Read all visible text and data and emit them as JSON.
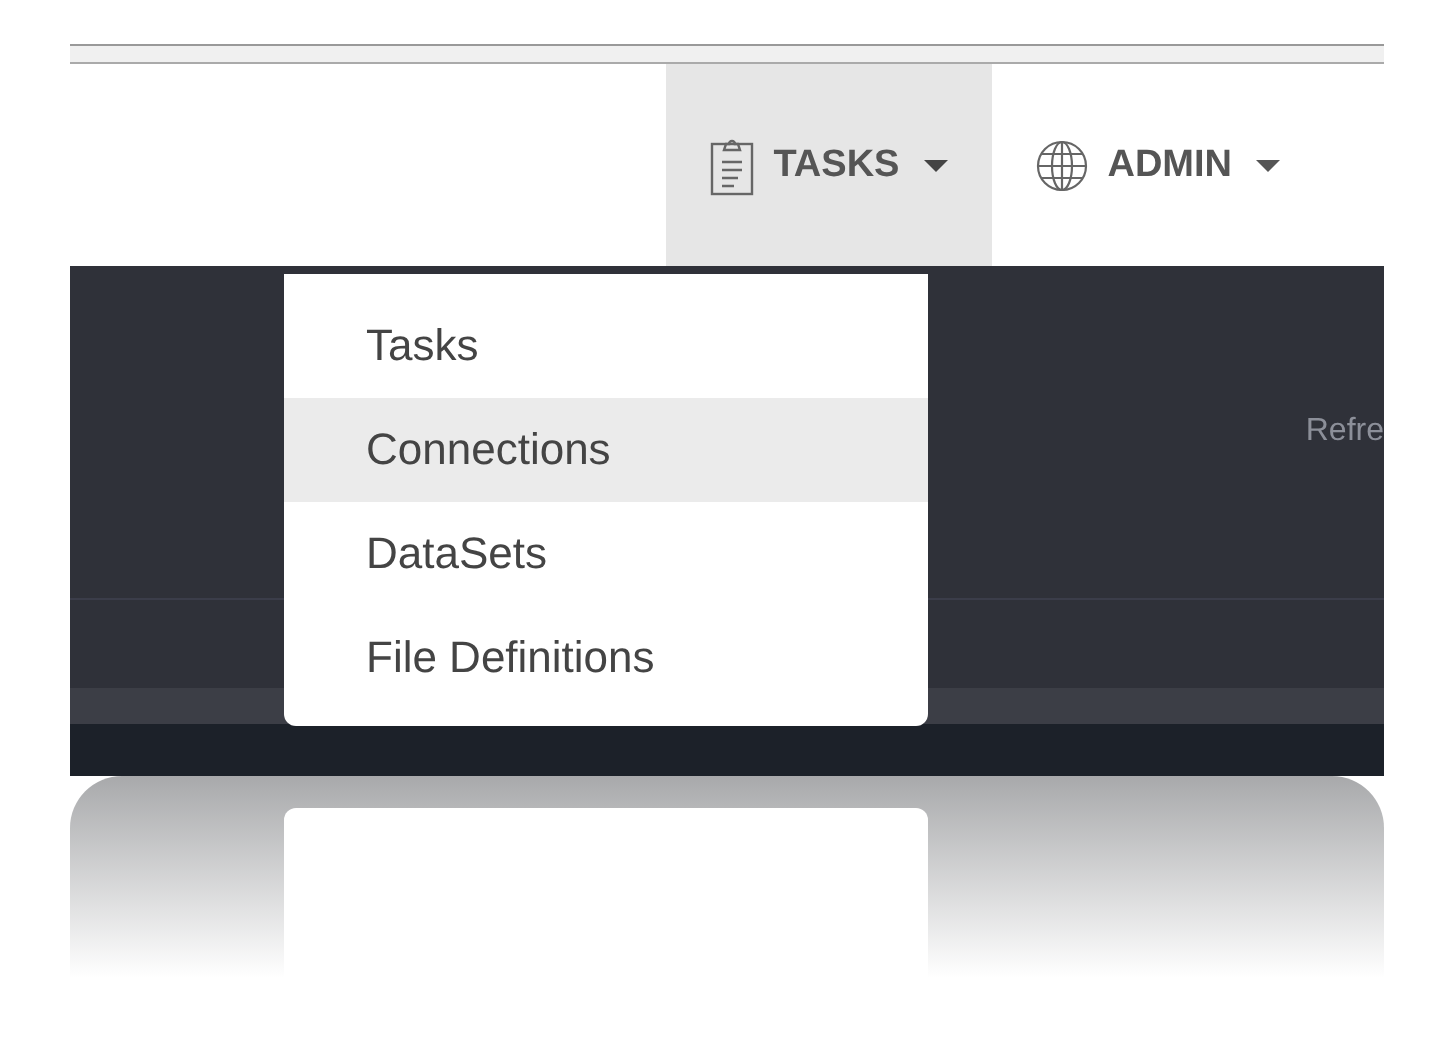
{
  "nav": {
    "buttons": [
      {
        "kind": "clipboard",
        "label": "TASKS",
        "selected": true,
        "expanded": true
      },
      {
        "kind": "globe",
        "label": "ADMIN",
        "selected": false,
        "expanded": false
      }
    ]
  },
  "menu": {
    "items": [
      {
        "label": "Tasks",
        "hovered": false
      },
      {
        "label": "Connections",
        "hovered": true
      },
      {
        "label": "DataSets",
        "hovered": false
      },
      {
        "label": "File Definitions",
        "hovered": false
      }
    ]
  },
  "panel": {
    "text": "Refre"
  }
}
